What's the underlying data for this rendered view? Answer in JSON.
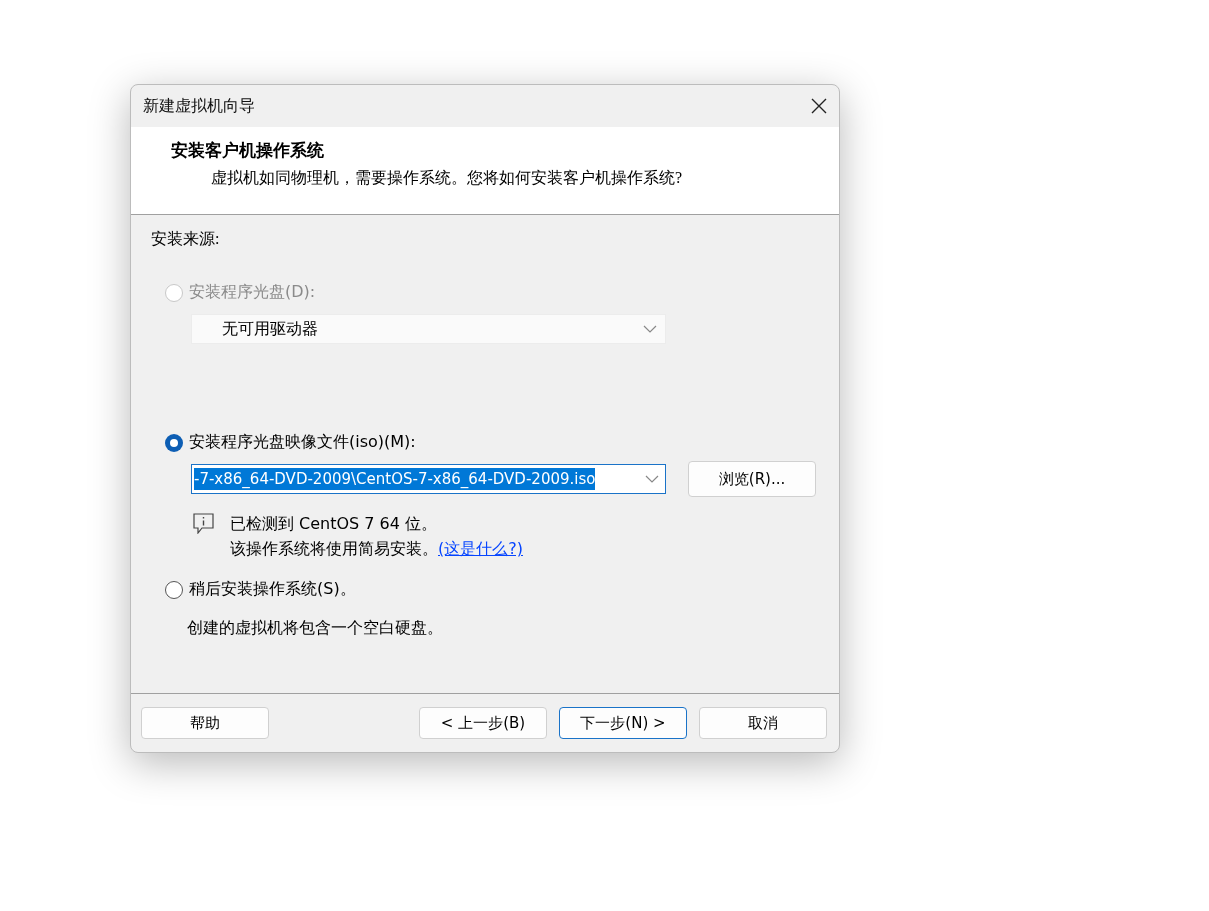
{
  "window": {
    "title": "新建虚拟机向导"
  },
  "header": {
    "title": "安装客户机操作系统",
    "subtitle": "虚拟机如同物理机，需要操作系统。您将如何安装客户机操作系统?"
  },
  "source_label": "安装来源:",
  "options": [
    {
      "kind": "disc",
      "label": "安装程序光盘(D):",
      "selected": false,
      "disabled": true,
      "dropdown": {
        "value": "无可用驱动器"
      }
    },
    {
      "kind": "iso",
      "label": "安装程序光盘映像文件(iso)(M):",
      "selected": true,
      "disabled": false,
      "path": {
        "value": "-7-x86_64-DVD-2009\\CentOS-7-x86_64-DVD-2009.iso",
        "text_selected": true
      },
      "browse_button": "浏览(R)...",
      "notice": {
        "lines": [
          "已检测到 CentOS 7 64 位。",
          "该操作系统将使用简易安装。"
        ],
        "link": "(这是什么?)"
      }
    },
    {
      "kind": "later",
      "label": "稍后安装操作系统(S)。",
      "selected": false,
      "disabled": false,
      "note": "创建的虚拟机将包含一个空白硬盘。"
    }
  ],
  "buttons": [
    {
      "kind": "help",
      "label": "帮助",
      "default": false
    },
    {
      "kind": "back",
      "label": "< 上一步(B)",
      "default": false
    },
    {
      "kind": "next",
      "label": "下一步(N) >",
      "default": true
    },
    {
      "kind": "cancel",
      "label": "取消",
      "default": false
    }
  ]
}
